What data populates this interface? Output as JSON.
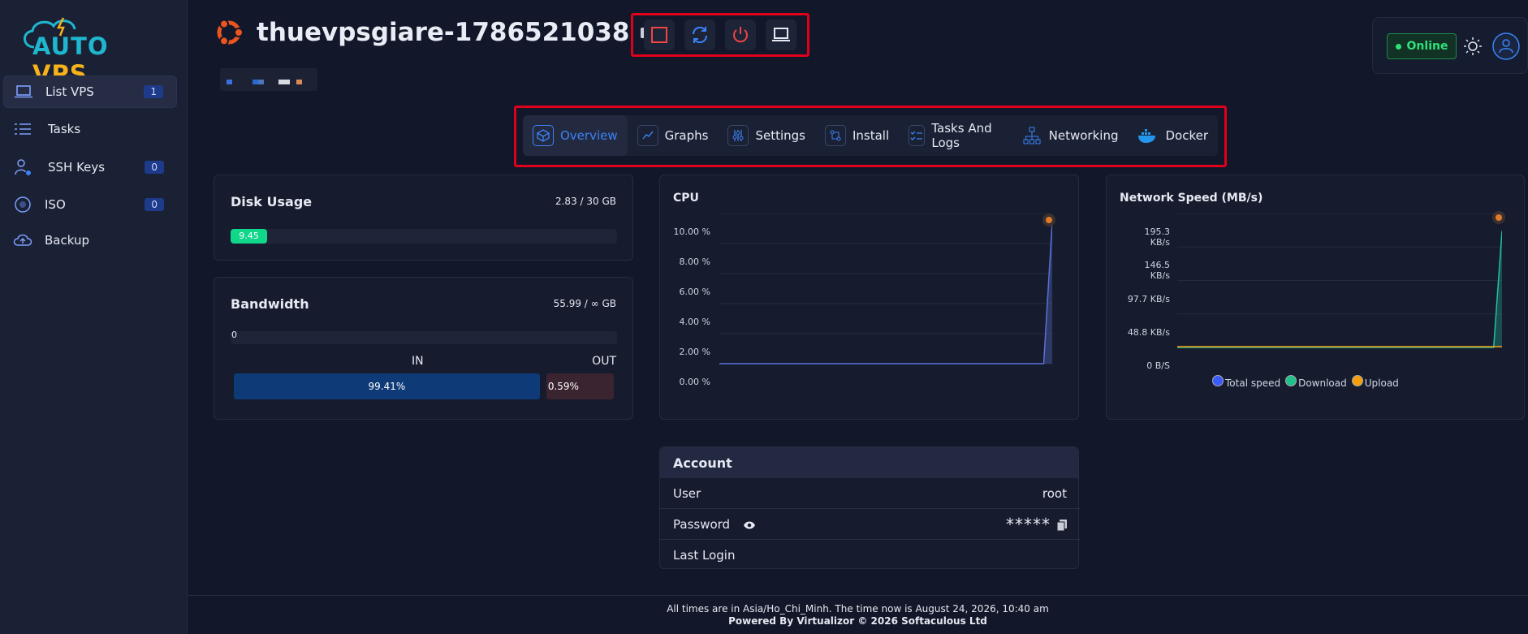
{
  "brand": {
    "logo_part1": "AUTO",
    "logo_part2": "VPS"
  },
  "sidebar": {
    "items": [
      {
        "label": "List VPS",
        "badge": "1",
        "icon": "laptop-icon"
      },
      {
        "label": "Tasks",
        "badge": "",
        "icon": "list-icon"
      },
      {
        "label": "SSH Keys",
        "badge": "0",
        "icon": "user-key-icon"
      },
      {
        "label": "ISO",
        "badge": "0",
        "icon": "disc-icon"
      },
      {
        "label": "Backup",
        "badge": "",
        "icon": "cloud-upload-icon"
      }
    ]
  },
  "header": {
    "vps_name": "thuevpsgiare-1786521038",
    "status": "Online"
  },
  "tabs": [
    {
      "label": "Overview",
      "icon": "cube-icon"
    },
    {
      "label": "Graphs",
      "icon": "chart-line-icon"
    },
    {
      "label": "Settings",
      "icon": "sliders-icon"
    },
    {
      "label": "Install",
      "icon": "install-icon"
    },
    {
      "label": "Tasks And Logs",
      "icon": "checklist-icon"
    },
    {
      "label": "Networking",
      "icon": "network-icon"
    },
    {
      "label": "Docker",
      "icon": "docker-icon"
    }
  ],
  "disk": {
    "title": "Disk Usage",
    "usage": "2.83 / 30 GB",
    "percent_label": "9.45",
    "percent": 9.45
  },
  "bandwidth": {
    "title": "Bandwidth",
    "usage": "55.99 / ∞ GB",
    "bar_value": "0",
    "in_label": "IN",
    "out_label": "OUT",
    "in_percent": "99.41%",
    "out_percent": "0.59%",
    "in_value": 99.41
  },
  "cpu": {
    "title": "CPU",
    "y_ticks": [
      "10.00 %",
      "8.00 %",
      "6.00 %",
      "4.00 %",
      "2.00 %",
      "0.00 %"
    ],
    "max": 10,
    "values": [
      0,
      0,
      0,
      0,
      0,
      0,
      0,
      0,
      0,
      0,
      0,
      0,
      0,
      0,
      0,
      0,
      0,
      0,
      0,
      0,
      0,
      0,
      0,
      0,
      0,
      0,
      0,
      0,
      0,
      0,
      0,
      0,
      0,
      0,
      0,
      0,
      0,
      0,
      0,
      9.4
    ]
  },
  "network": {
    "title": "Network Speed (MB/s)",
    "y_ticks": [
      "195.3 KB/s",
      "146.5 KB/s",
      "97.7 KB/s",
      "48.8 KB/s",
      "0 B/S"
    ],
    "max": 195.3,
    "total": [
      0,
      0,
      0,
      0,
      0,
      0,
      0,
      0,
      0,
      0,
      0,
      0,
      0,
      0,
      0,
      0,
      0,
      0,
      0,
      0,
      0,
      0,
      0,
      0,
      0,
      0,
      0,
      0,
      0,
      0,
      0,
      0,
      0,
      0,
      0,
      0,
      0,
      0,
      0,
      170
    ],
    "legend": [
      "Total speed",
      "Download",
      "Upload"
    ],
    "colors": [
      "#3b5bfd",
      "#22c08a",
      "#f59e0b"
    ]
  },
  "account": {
    "title": "Account",
    "rows": [
      {
        "key": "User",
        "value": "root"
      },
      {
        "key": "Password",
        "value": "*****"
      },
      {
        "key": "Last Login",
        "value": ""
      }
    ]
  },
  "footer": {
    "line1": "All times are in Asia/Ho_Chi_Minh. The time now is August 24, 2026, 10:40 am",
    "line2": "Powered By Virtualizor © 2026 Softaculous Ltd"
  }
}
